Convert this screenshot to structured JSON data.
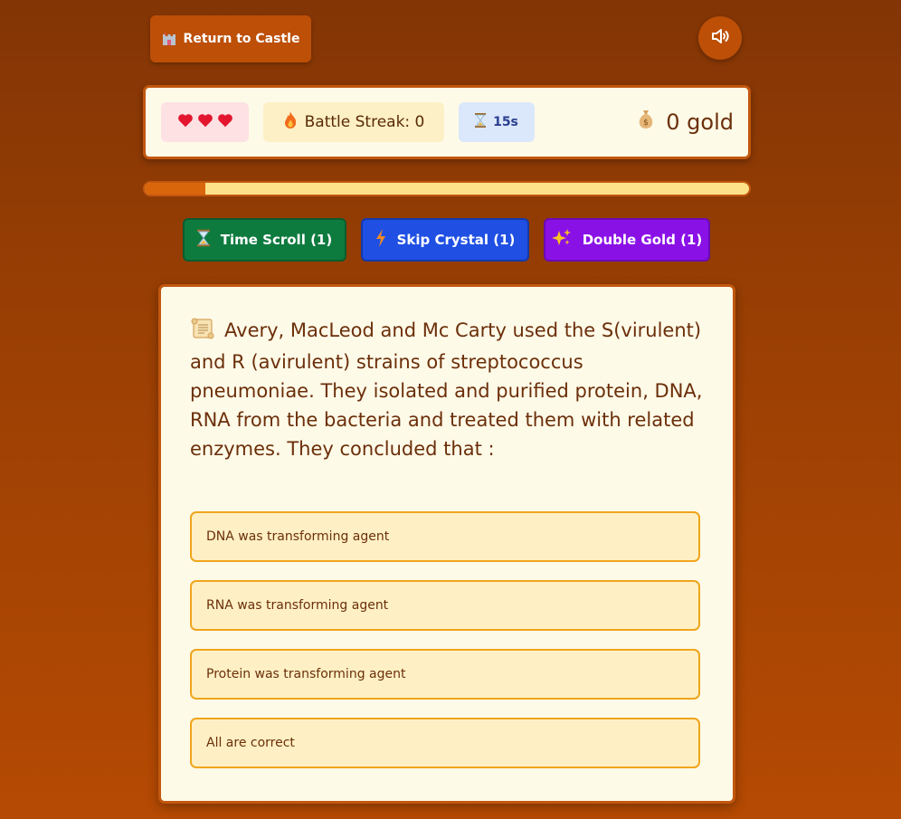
{
  "nav": {
    "back_label": "Return to Castle",
    "sound_icon": "speaker-volume-icon"
  },
  "status": {
    "lives": 3,
    "streak_label": "Battle Streak: 0",
    "timer_label": "15s",
    "gold_label": "0 gold"
  },
  "progress": {
    "fraction": 0.1
  },
  "powerups": {
    "time_scroll": "Time Scroll (1)",
    "skip_crystal": "Skip Crystal (1)",
    "double_gold": "Double Gold (1)"
  },
  "question": {
    "text": "Avery, MacLeod and Mc Carty used the S(virulent) and R (avirulent) strains of streptococcus pneumoniae. They isolated and purified protein, DNA, RNA from the bacteria and treated them with related enzymes. They concluded that :",
    "options": [
      "DNA was transforming agent",
      "RNA was transforming agent",
      "Protein was transforming agent",
      "All are correct"
    ]
  },
  "colors": {
    "accent": "#bd4f07",
    "panel": "#fefae8",
    "option_bg": "#fef0c4",
    "option_border": "#f0a51c",
    "time_scroll": "#0e7b3e",
    "skip_crystal": "#1f4fe3",
    "double_gold": "#8a11e6"
  }
}
